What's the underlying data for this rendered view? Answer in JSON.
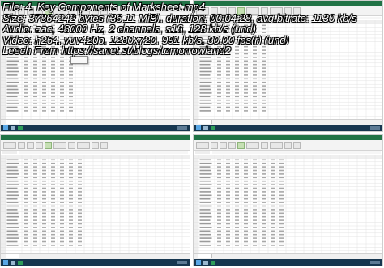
{
  "mediainfo": {
    "file_line": "File: 4. Key Components of Marksheet.mp4",
    "size_line": "Size: 37864242 bytes (36.11 MiB), duration: 00:04:28, avg.bitrate: 1130 kb/s",
    "audio_line": "Audio: aac, 48000 Hz, 2 channels, s16, 128 kb/s (und)",
    "video_line": "Video: h264, yuv420p, 1280x720, 991 kb/s, 30.00 fps(r) (und)",
    "leech_line": "Leech From https://sanet.st/blogs/tomorrowland2"
  },
  "colors": {
    "excel_green": "#217346",
    "taskbar": "#16364f",
    "grid_line": "#e2e2e2",
    "header_bg": "#efefef"
  },
  "thumbnails": [
    {
      "id": "thumb-1",
      "data_cols": 6,
      "shows_popup": true
    },
    {
      "id": "thumb-2",
      "data_cols": 6,
      "shows_popup": false
    },
    {
      "id": "thumb-3",
      "data_cols": 7,
      "shows_popup": false
    },
    {
      "id": "thumb-4",
      "data_cols": 8,
      "shows_popup": false
    }
  ],
  "icons": {
    "start": "windows-start-icon",
    "explorer": "file-explorer-icon",
    "excel": "excel-app-icon"
  }
}
